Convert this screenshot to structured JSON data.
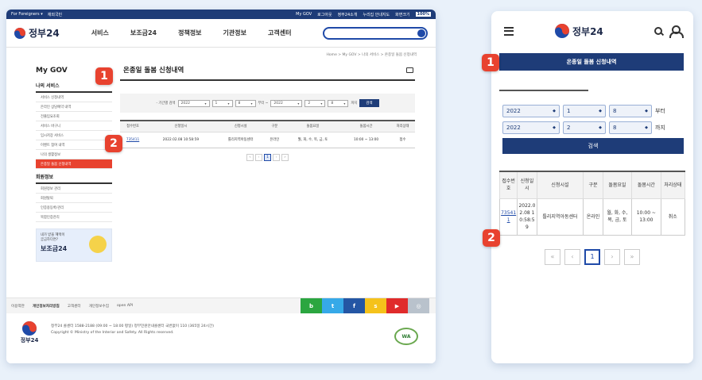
{
  "desktop": {
    "topbar": {
      "lang": [
        "For Foreigners ▾",
        "재외국민"
      ],
      "links": [
        "My GOV",
        "로그아웃",
        "정부24소개",
        "누리집 안내지도",
        "화면크기"
      ],
      "zoom": "100%"
    },
    "logo": "정부24",
    "gnb": [
      "서비스",
      "보조금24",
      "정책정보",
      "기관정보",
      "고객센터"
    ],
    "breadcrumb": "Home > My GOV > 나의 서비스 > 온종일 돌봄 신청내역",
    "side": {
      "title": "My GOV",
      "section1": "나의 서비스",
      "items1": [
        "서비스 신청내역",
        "온라인 상담예약 내역",
        "전출입요조회",
        "서비스 바구니",
        "임시저장 서비스",
        "이벤트 참여 내역",
        "나의 생활정보",
        "온종일 돌봄 신청내역"
      ],
      "section2": "회원정보",
      "items2": [
        "회원정보 관리",
        "회원탈퇴",
        "인증용등록/관리",
        "복합인증관리"
      ],
      "banner_sub1": "내가 받을 혜택이",
      "banner_sub2": "궁금하다면?",
      "banner_title": "보조금24"
    },
    "content": {
      "title": "온종일 돌봄 신청내역",
      "filter_label": "- 기간별 검색",
      "from": {
        "year": "2022",
        "month": "1",
        "day": "8"
      },
      "from_suffix": "부터 ~",
      "to": {
        "year": "2022",
        "month": "2",
        "day": "8"
      },
      "to_suffix": "까지",
      "search": "검색",
      "table_headers": [
        "접수번호",
        "신청일시",
        "신청시설",
        "구분",
        "돌봄요일",
        "돌봄시간",
        "처리상태"
      ],
      "rows": [
        {
          "no": "735411",
          "date": "2022.02.08 10:58:59",
          "facility": "틀리지역아동센터",
          "type": "온라인",
          "days": "월, 화, 수, 목, 금, 토",
          "time": "10:00 ~ 13:00",
          "status": "접수"
        }
      ],
      "pager": [
        "«",
        "‹",
        "1",
        "›",
        "»"
      ]
    },
    "footer_nav": [
      "이용약관",
      "개인정보처리방침",
      "고객센터",
      "개인정보수집",
      "open API"
    ],
    "sns": [
      "b",
      "t",
      "f",
      "s",
      "▶",
      "◎"
    ],
    "footer_logo": "정부24",
    "footer_text1": "정부24 콜센터 1588-2188 (09:00 ~ 18:00 평일) 정부민원안내콜센터 국번없이 110 (365일 24시간)",
    "footer_text2": "Copyright © Ministry of the Interior and Safety. All Rights reserved.",
    "wa_mark": "WA"
  },
  "mobile": {
    "logo": "정부24",
    "title": "온종일 돌봄 신청내역",
    "from": {
      "year": "2022",
      "month": "1",
      "day": "8"
    },
    "from_suffix": "부터",
    "to": {
      "year": "2022",
      "month": "2",
      "day": "8"
    },
    "to_suffix": "까지",
    "search": "검색",
    "table_headers": [
      "접수번호",
      "신청일시",
      "신청시설",
      "구분",
      "돌봄요일",
      "돌봄시간",
      "처리상태"
    ],
    "row": {
      "no": "735411",
      "date": "2022.02.08 10:58:59",
      "facility": "틀리지역아동센터",
      "type": "온라인",
      "days": "월, 화, 수, 목, 금, 토",
      "time": "10:00 ~ 13:00",
      "status": "취소"
    },
    "pager": [
      "«",
      "‹",
      "1",
      "›",
      "»"
    ]
  },
  "callouts": [
    "1",
    "2"
  ],
  "colors": {
    "navy": "#1e3c78",
    "accent_red": "#e8422f",
    "blue": "#1f4aa8"
  }
}
